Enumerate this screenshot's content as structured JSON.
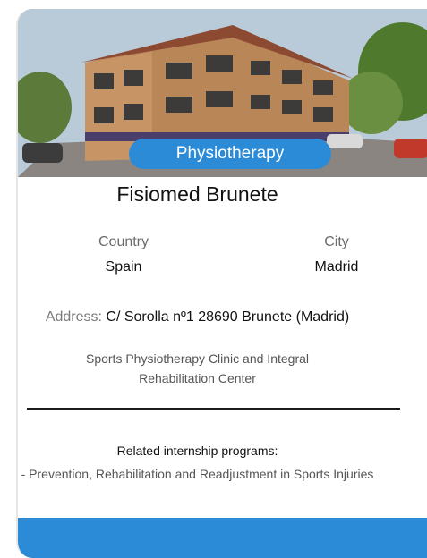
{
  "card": {
    "category": "Physiotherapy",
    "title": "Fisiomed Brunete",
    "country_label": "Country",
    "country_value": "Spain",
    "city_label": "City",
    "city_value": "Madrid",
    "address_label": "Address:",
    "address_value": "C/ Sorolla nº1 28690 Brunete (Madrid)",
    "description_line1": "Sports Physiotherapy Clinic and Integral",
    "description_line2": "Rehabilitation Center",
    "related_heading": "Related internship programs:",
    "related_programs": [
      "- Prevention, Rehabilitation and Readjustment in Sports Injuries"
    ]
  },
  "colors": {
    "accent": "#2b8bd6",
    "text_primary": "#111111",
    "text_muted": "#6b6b6b"
  }
}
